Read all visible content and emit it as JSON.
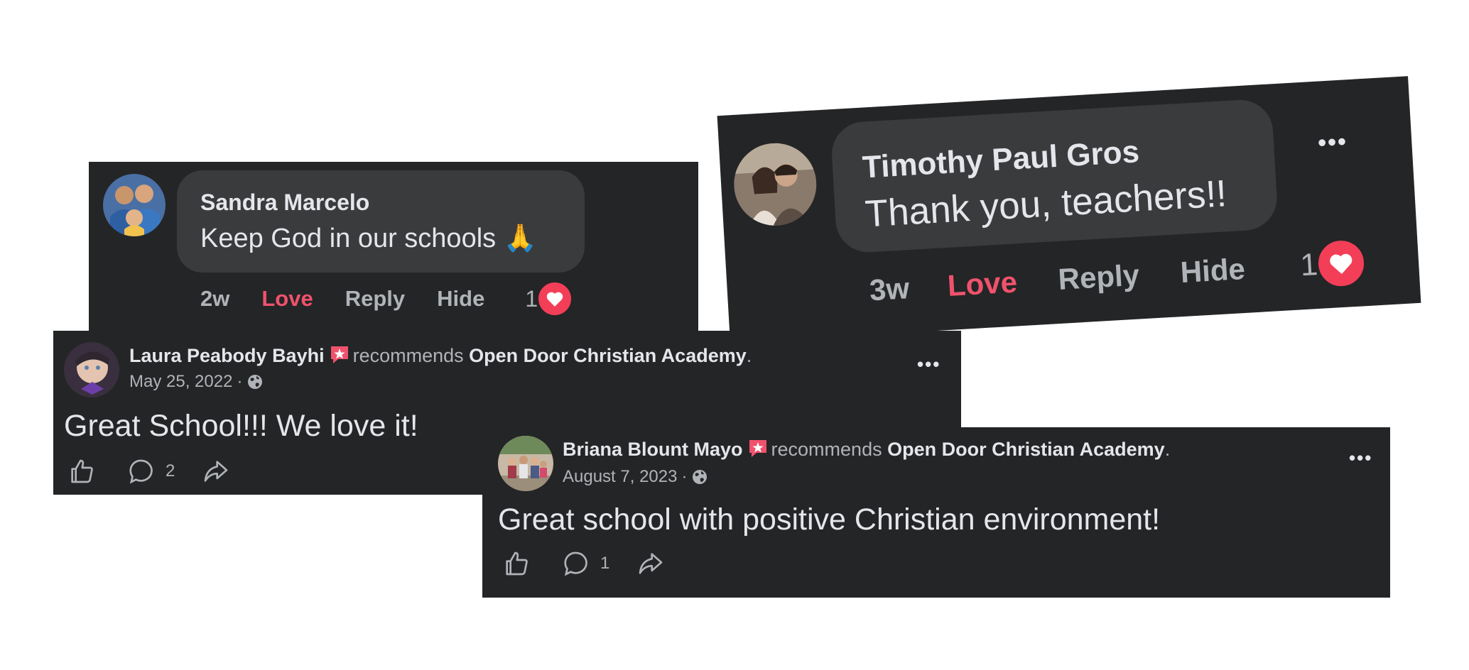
{
  "comments": [
    {
      "author": "Sandra Marcelo",
      "text": "Keep God in our schools 🙏",
      "time": "2w",
      "love_label": "Love",
      "reply_label": "Reply",
      "hide_label": "Hide",
      "reaction_count": "1"
    },
    {
      "author": "Timothy Paul Gros",
      "text": "Thank you, teachers!!",
      "time": "3w",
      "love_label": "Love",
      "reply_label": "Reply",
      "hide_label": "Hide",
      "reaction_count": "1",
      "more_label": "•••"
    }
  ],
  "posts": [
    {
      "author": "Laura Peabody Bayhi",
      "recommends_label": "recommends",
      "page": "Open Door Christian Academy",
      "period": ".",
      "date": "May 25, 2022",
      "separator": "·",
      "text": "Great School!!! We love it!",
      "comment_count": "2",
      "more_label": "•••"
    },
    {
      "author": "Briana Blount Mayo",
      "recommends_label": "recommends",
      "page": "Open Door Christian Academy",
      "period": ".",
      "date": "August 7, 2023",
      "separator": "·",
      "text": "Great school with positive Christian environment!",
      "comment_count": "1",
      "more_label": "•••"
    }
  ],
  "colors": {
    "card_bg": "#242526",
    "bubble_bg": "#3a3b3c",
    "text_primary": "#e4e6eb",
    "text_secondary": "#b0b3b8",
    "love_red": "#f0526d",
    "heart_red": "#f33e58",
    "recommend_badge": "#f0526d"
  },
  "icons": [
    "globe-icon",
    "like-icon",
    "comment-icon",
    "share-icon",
    "heart-icon",
    "recommend-badge-icon",
    "more-icon"
  ]
}
